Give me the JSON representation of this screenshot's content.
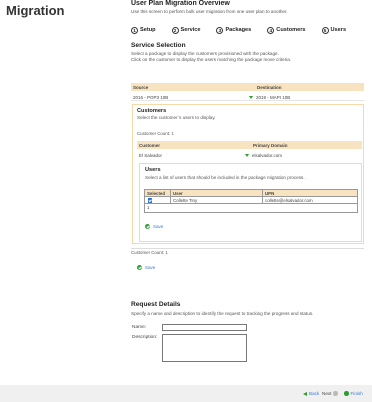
{
  "page": {
    "title": "Migration"
  },
  "overview": {
    "title": "User Plan Migration Overview",
    "description": "Use this screen to perform bulk user migration from one user plan to another."
  },
  "steps": [
    {
      "num": "1",
      "label": "Setup"
    },
    {
      "num": "2",
      "label": "Service"
    },
    {
      "num": "3",
      "label": "Packages"
    },
    {
      "num": "4",
      "label": "Customers"
    },
    {
      "num": "5",
      "label": "Users"
    }
  ],
  "service_selection": {
    "title": "Service Selection",
    "desc_line1": "Select a package to display the customers provisioned with the package.",
    "desc_line2": "Click on the customer to display the users matching the package move criteria.",
    "col_source": "Source",
    "col_destination": "Destination",
    "row": {
      "source": "2016 - POP3 10B",
      "destination": "2019 - MAPI 10B"
    }
  },
  "customers": {
    "title": "Customers",
    "description": "Select the customer`s users to display.",
    "count_text": "Customer Count: 1",
    "col_customer": "Customer",
    "col_domain": "Primary Domain",
    "row": {
      "customer": "El Salvador",
      "domain": "elsalvador.com"
    },
    "count_text_bottom": "Customer Count: 1"
  },
  "users": {
    "title": "Users",
    "description": "Select a list of users that should be included in the package migration process.",
    "col_selected": "Selected",
    "col_user": "User",
    "col_upn": "UPN",
    "rows": [
      {
        "user": "Collette Tiny",
        "upn": "collette@elsalvador.com"
      }
    ],
    "footer_value": "1"
  },
  "actions": {
    "save_label": "Save"
  },
  "request": {
    "title": "Request Details",
    "description": "Specify a name and description to identify the request to tracking the progress and status.",
    "name_label": "Name:",
    "desc_label": "Description:",
    "name_value": "",
    "desc_value": ""
  },
  "nav": {
    "back": "Back",
    "next": "Next",
    "finish": "Finish"
  },
  "colors": {
    "header_bg": "#f8e3c0",
    "box_border": "#f5d9a8",
    "accent_green": "#2e9e2e",
    "link_blue": "#3a7bd5"
  }
}
